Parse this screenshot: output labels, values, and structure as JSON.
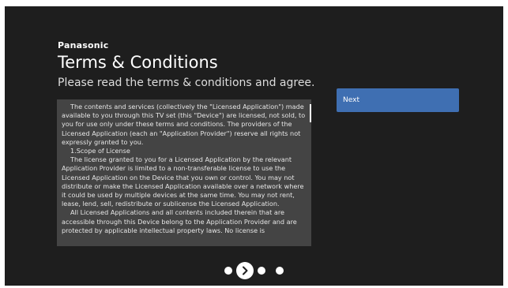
{
  "header": {
    "brand": "Panasonic",
    "title": "Terms & Conditions",
    "subtitle": "Please read the terms & conditions and agree."
  },
  "terms": {
    "paragraphs": [
      "The contents and services (collectively the \"Licensed Application\") made available to you through this TV set (this \"Device\") are licensed, not sold, to you for use only under these terms and conditions. The providers of the Licensed Application (each an \"Application Provider\") reserve all rights not expressly granted to you.",
      "1.Scope of License",
      "The license granted to you for a Licensed Application by the relevant Application Provider is limited to a non-transferable license to use the Licensed Application on the Device that you own or control. You may not distribute or make the Licensed Application available over a network where it could be used by multiple devices at the same time. You may not rent, lease, lend, sell, redistribute or sublicense the Licensed Application.",
      "All Licensed Applications and all contents included therein that are accessible through this Device belong to the Application Provider and are protected by applicable intellectual property laws. No license is"
    ]
  },
  "actions": {
    "next_label": "Next"
  },
  "pager": {
    "icon": "chevron-right-icon"
  },
  "colors": {
    "background": "#1e1e1e",
    "terms_box": "#444444",
    "next_button": "#3f6fb2",
    "text": "#ffffff"
  }
}
